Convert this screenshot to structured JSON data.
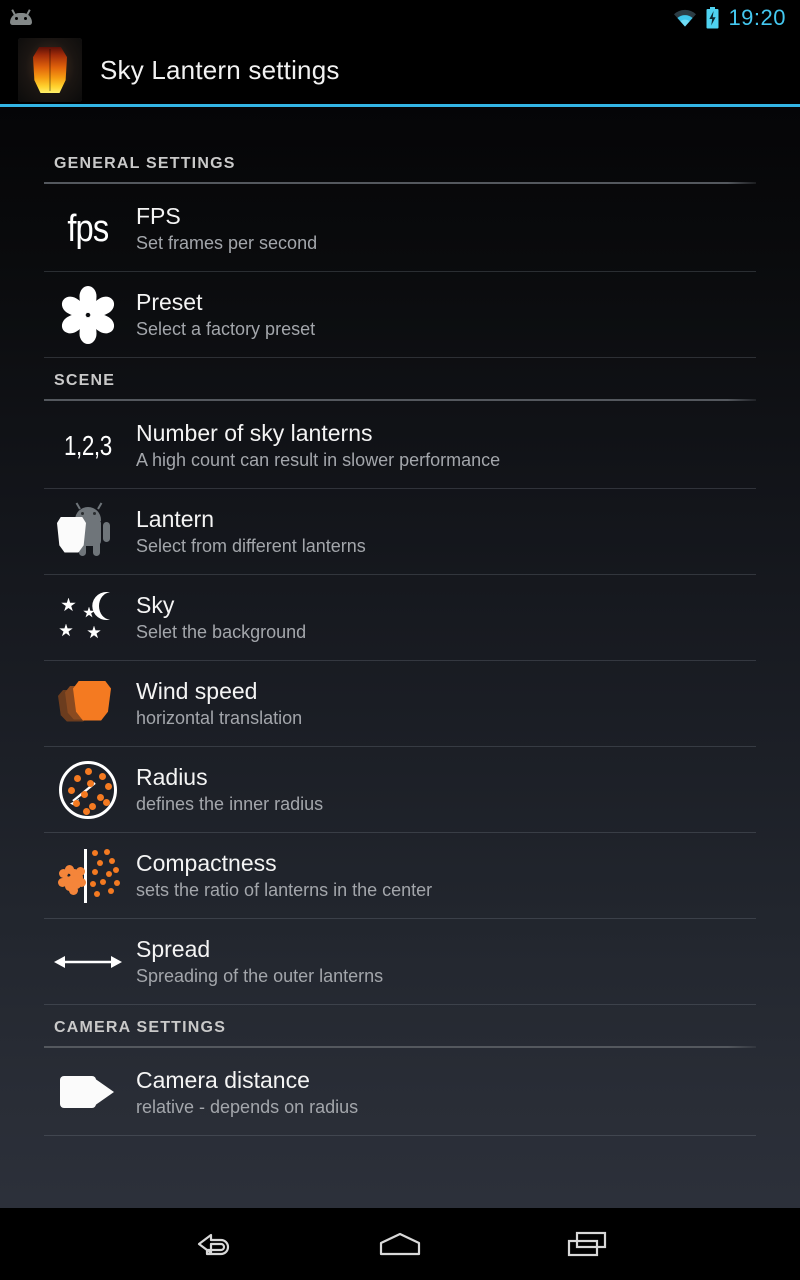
{
  "status_bar": {
    "notification_icon": "android-notification-icon",
    "wifi_icon": "wifi-icon",
    "battery_icon": "battery-charging-icon",
    "time": "19:20",
    "time_color": "#44c8f0"
  },
  "action_bar": {
    "app_icon": "sky-lantern-app-icon",
    "title": "Sky Lantern settings",
    "accent_color": "#33b5e5"
  },
  "sections": [
    {
      "header": "GENERAL SETTINGS",
      "rows": [
        {
          "icon": "fps-icon",
          "icon_text": "fps",
          "title": "FPS",
          "subtitle": "Set frames per second"
        },
        {
          "icon": "flower-icon",
          "icon_text": "",
          "title": "Preset",
          "subtitle": "Select a factory preset"
        }
      ]
    },
    {
      "header": "SCENE",
      "rows": [
        {
          "icon": "numbers-icon",
          "icon_text": "1,2,3",
          "title": "Number of sky lanterns",
          "subtitle": "A high count can result in slower performance"
        },
        {
          "icon": "lantern-android-icon",
          "icon_text": "",
          "title": "Lantern",
          "subtitle": "Select from different lanterns"
        },
        {
          "icon": "moon-stars-icon",
          "icon_text": "",
          "title": "Sky",
          "subtitle": "Selet the background"
        },
        {
          "icon": "wind-lantern-icon",
          "icon_text": "",
          "title": "Wind speed",
          "subtitle": "horizontal translation"
        },
        {
          "icon": "radius-circle-icon",
          "icon_text": "",
          "title": "Radius",
          "subtitle": "defines the inner radius"
        },
        {
          "icon": "compactness-icon",
          "icon_text": "",
          "title": "Compactness",
          "subtitle": "sets the ratio of lanterns in the center"
        },
        {
          "icon": "spread-arrow-icon",
          "icon_text": "",
          "title": "Spread",
          "subtitle": "Spreading of the outer lanterns"
        }
      ]
    },
    {
      "header": "CAMERA SETTINGS",
      "rows": [
        {
          "icon": "video-camera-icon",
          "icon_text": "",
          "title": "Camera distance",
          "subtitle": "relative - depends on radius"
        }
      ]
    }
  ],
  "nav_bar": {
    "back": "back-icon",
    "home": "home-icon",
    "recents": "recents-icon"
  },
  "theme": {
    "accent": "#33b5e5",
    "orange": "#f47a21",
    "title_text": "#f4f4f4",
    "sub_text": "#a3a6ab",
    "section_text": "#c9c9c9"
  }
}
